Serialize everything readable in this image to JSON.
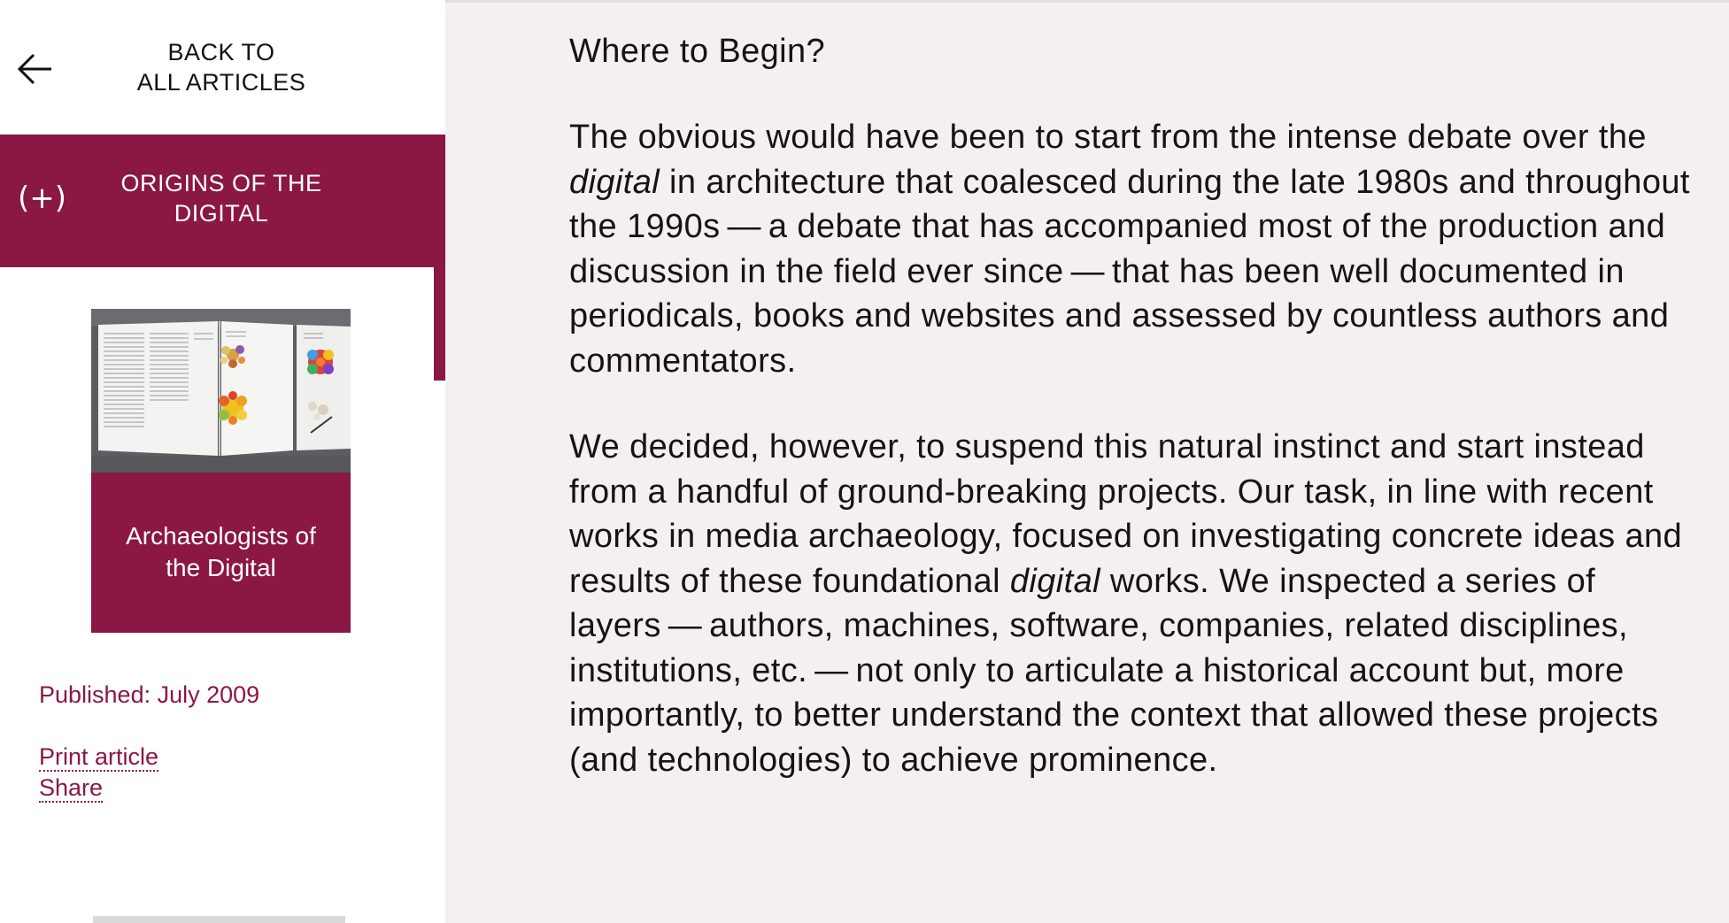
{
  "sidebar": {
    "back_line1": "BACK TO",
    "back_line2": "ALL ARTICLES",
    "section_toggle": "(+)",
    "section_title_line1": "ORIGINS OF THE",
    "section_title_line2": "DIGITAL",
    "article_card": {
      "caption_line1": "Archaeologists of",
      "caption_line2": "the Digital"
    },
    "published": "Published: July 2009",
    "print_label": "Print article",
    "share_label": "Share"
  },
  "article": {
    "heading": "Where to Begin?",
    "p1": {
      "a": "The obvious would have been to start from the intense debate over the ",
      "em": "digital",
      "b": " in architecture that coalesced during the late 1980s and throughout the 1990s — a debate that has accompanied most of the production and discussion in the field ever since — that has been well documented in periodicals, books and websites and assessed by countless authors and commentators."
    },
    "p2": {
      "a": "We decided, however, to suspend this natural instinct and start instead from a handful of ground-breaking projects. Our task, in line with recent works in media archaeology, focused on investigating concrete ideas and results of these foundational ",
      "em": "digital",
      "b": " works. We inspected a series of layers — authors, machines, software, companies, related disciplines, institutions, etc. — not only to articulate a historical account but, more importantly, to better understand the context that allowed these projects (and technologies) to achieve prominence."
    }
  },
  "colors": {
    "accent": "#8a1744",
    "main_background": "#f5eff2",
    "text": "#141414"
  },
  "icons": {
    "back": "arrow-left-icon"
  }
}
